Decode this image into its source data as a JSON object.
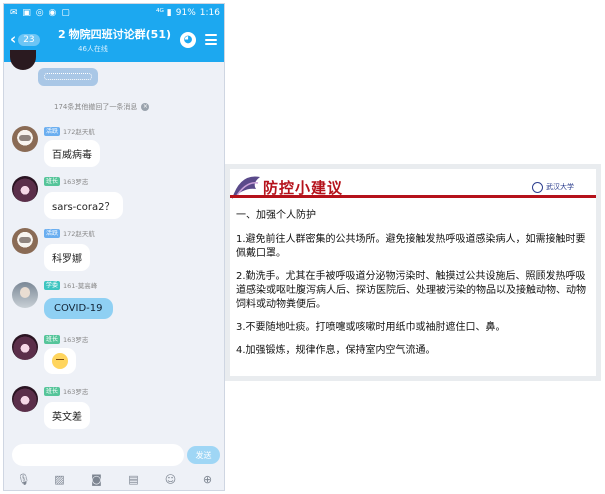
{
  "status_bar": {
    "left_icons": "✉ ▣ ◎ ◉ ▢",
    "signal": "⁴ᴳ ▮",
    "battery": "91%",
    "time": "1:16"
  },
  "header": {
    "back_chevron": "‹",
    "unread_count": "23",
    "group_number_icon": "2",
    "title": "物院四班讨论群(51)",
    "subtitle": "46人在线"
  },
  "chat": {
    "recall_notice": "174条其他撤回了一条消息",
    "messages": [
      {
        "tag": "活跃",
        "sender": "172赵天航",
        "text": "百威病毒"
      },
      {
        "tag": "班长",
        "sender": "163罗志",
        "text": "sars-cora2？"
      },
      {
        "tag": "活跃",
        "sender": "172赵天航",
        "text": "科罗娜"
      },
      {
        "tag": "学委",
        "sender": "161-莫高峰",
        "text": "COVID-19"
      },
      {
        "tag": "班长",
        "sender": "163罗志",
        "text": ""
      },
      {
        "tag": "班长",
        "sender": "163罗志",
        "text": "英文差"
      }
    ]
  },
  "composer": {
    "input_value": "",
    "send_label": "发送"
  },
  "toolbar_icons": [
    "microphone-icon",
    "image-icon",
    "camera-icon",
    "red-packet-icon",
    "emoji-icon",
    "plus-icon"
  ],
  "slide": {
    "title": "防控小建议",
    "logo_text": "武汉大学",
    "heading": "一、加强个人防护",
    "points": [
      "1.避免前往人群密集的公共场所。避免接触发热呼吸道感染病人，如需接触时要佩戴口罩。",
      "2.勤洗手。尤其在手被呼吸道分泌物污染时、触摸过公共设施后、照顾发热呼吸道感染或呕吐腹泻病人后、探访医院后、处理被污染的物品以及接触动物、动物饲料或动物粪便后。",
      "3.不要随地吐痰。打喷嚏或咳嗽时用纸巾或袖肘遮住口、鼻。",
      "4.加强锻炼，规律作息，保持室内空气流通。"
    ]
  },
  "colors": {
    "accent": "#1ca8f0",
    "slide_red": "#b5121b"
  }
}
